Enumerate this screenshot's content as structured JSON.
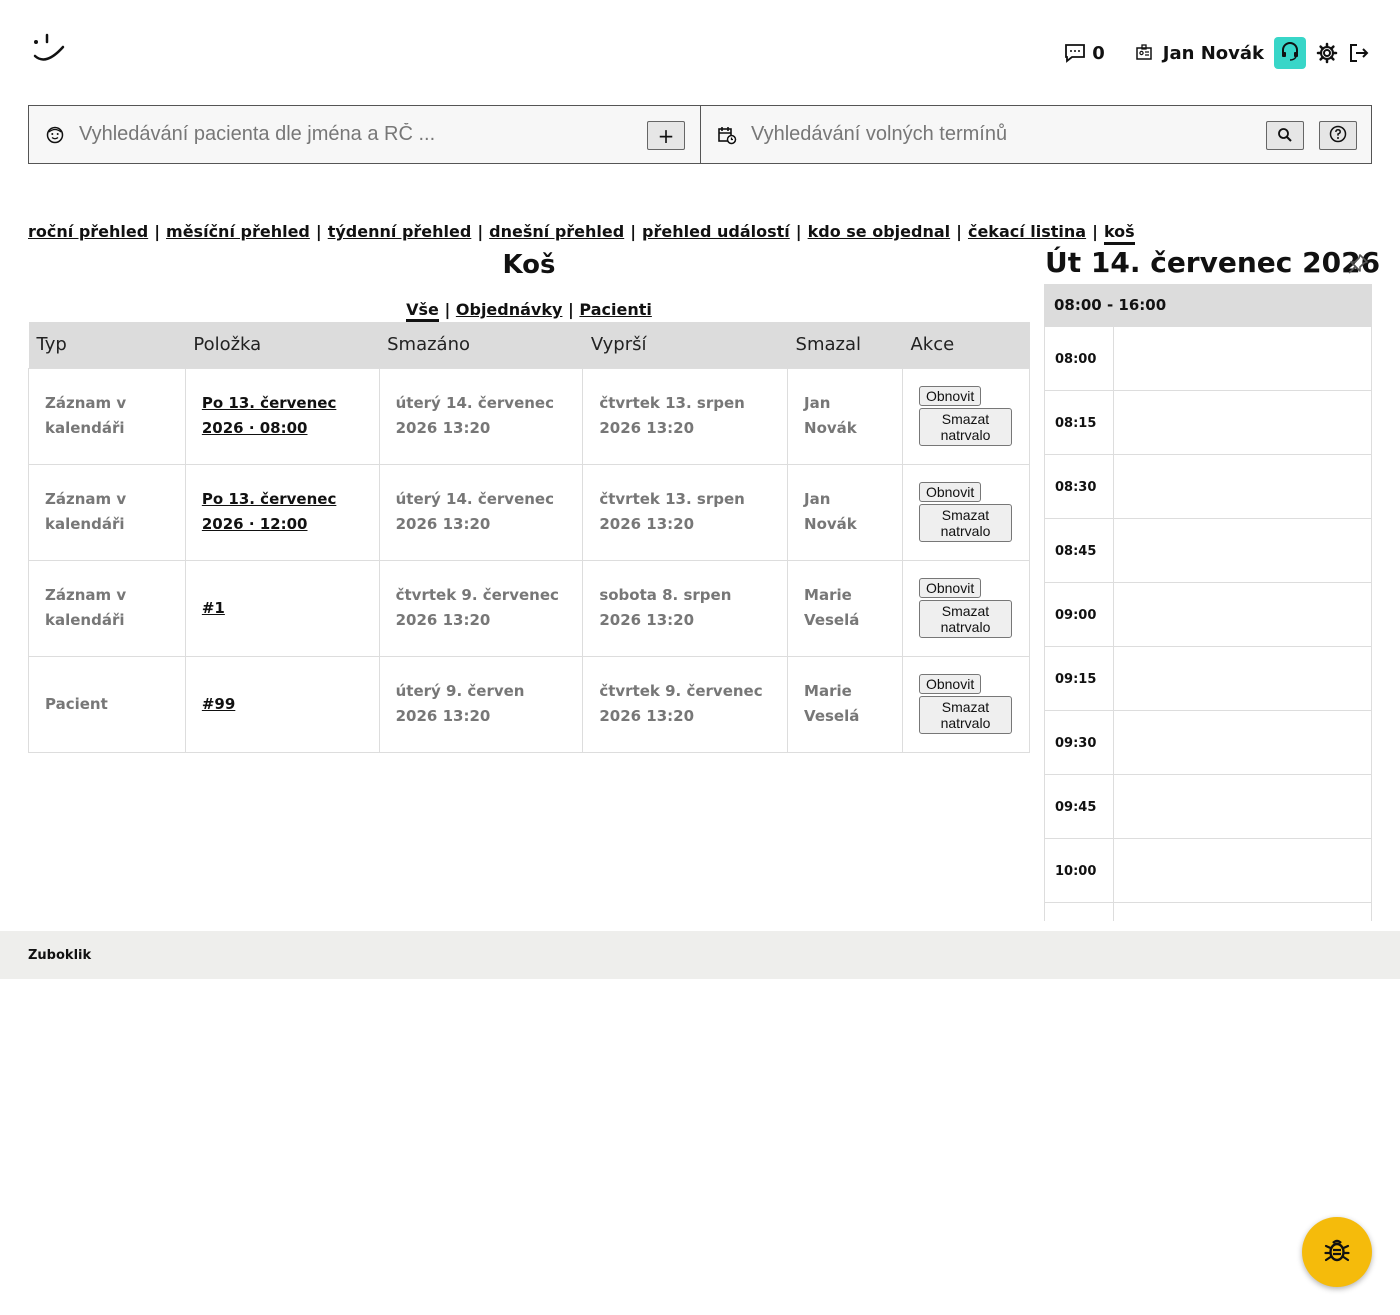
{
  "header": {
    "messages_count": "0",
    "user_name": "Jan Novák"
  },
  "search": {
    "patient_placeholder": "Vyhledávání pacienta dle jména a RČ ...",
    "add_label": "+",
    "slots_placeholder": "Vyhledávání volných termínů"
  },
  "nav": {
    "items": [
      {
        "label": "roční přehled"
      },
      {
        "label": "měsíční přehled"
      },
      {
        "label": "týdenní přehled"
      },
      {
        "label": "dnešní přehled"
      },
      {
        "label": "přehled událostí"
      },
      {
        "label": "kdo se objednal"
      },
      {
        "label": "čekací listina"
      },
      {
        "label": "koš",
        "active": true
      }
    ]
  },
  "main": {
    "title": "Koš",
    "filters": [
      {
        "label": "Vše",
        "active": true
      },
      {
        "label": "Objednávky"
      },
      {
        "label": "Pacienti"
      }
    ],
    "columns": [
      "Typ",
      "Položka",
      "Smazáno",
      "Vyprší",
      "Smazal",
      "Akce"
    ],
    "restore_label": "Obnovit",
    "delete_label": "Smazat natrvalo",
    "rows": [
      {
        "type": "Záznam v kalendáři",
        "item": "Po 13. červenec 2026 · 08:00",
        "deleted": "úterý 14. červenec 2026 13:20",
        "expires": "čtvrtek 13. srpen 2026 13:20",
        "by": "Jan Novák"
      },
      {
        "type": "Záznam v kalendáři",
        "item": "Po 13. červenec 2026 · 12:00",
        "deleted": "úterý 14. červenec 2026 13:20",
        "expires": "čtvrtek 13. srpen 2026 13:20",
        "by": "Jan Novák"
      },
      {
        "type": "Záznam v kalendáři",
        "item": "#1",
        "deleted": "čtvrtek 9. červenec 2026 13:20",
        "expires": "sobota 8. srpen 2026 13:20",
        "by": "Marie Veselá"
      },
      {
        "type": "Pacient",
        "item": "#99",
        "deleted": "úterý 9. červen 2026 13:20",
        "expires": "čtvrtek 9. červenec 2026 13:20",
        "by": "Marie Veselá"
      }
    ]
  },
  "calendar": {
    "date_title": "Út 14. červenec 2026",
    "hours_range": "08:00 - 16:00",
    "slots": [
      "08:00",
      "08:15",
      "08:30",
      "08:45",
      "09:00",
      "09:15",
      "09:30",
      "09:45",
      "10:00",
      ""
    ]
  },
  "footer": {
    "brand": "Zuboklik"
  },
  "colors": {
    "accent_support": "#38d6c8",
    "bug_button": "#f5bb0b",
    "header_row": "#dcdcdc",
    "footer_bg": "#eeeeec"
  }
}
